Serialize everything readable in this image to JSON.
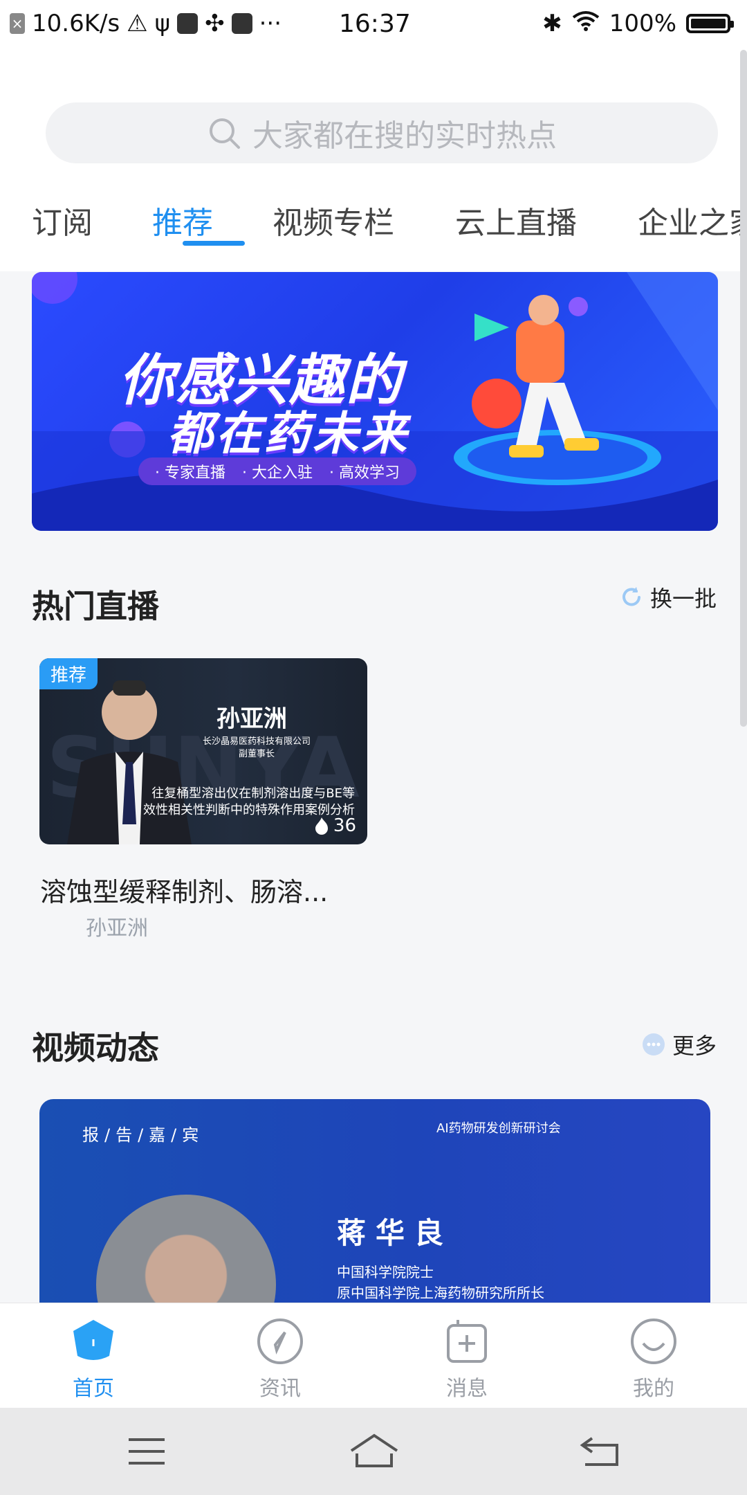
{
  "status_bar": {
    "speed": "10.6K/s",
    "time": "16:37",
    "battery": "100%",
    "more": "···"
  },
  "search": {
    "placeholder": "大家都在搜的实时热点"
  },
  "tabs": [
    "订阅",
    "推荐",
    "视频专栏",
    "云上直播",
    "企业之家"
  ],
  "active_tab": "推荐",
  "banner": {
    "title_line1": "你感兴趣的",
    "title_line2": "都在药未来",
    "tags": [
      "· 专家直播",
      "· 大企入驻",
      "· 高效学习"
    ]
  },
  "hot_live": {
    "section_title": "热门直播",
    "refresh_label": "换一批",
    "card": {
      "badge": "推荐",
      "speaker_name": "孙亚洲",
      "speaker_company": "长沙晶易医药科技有限公司",
      "speaker_role": "副董事长",
      "desc_line1": "往复桶型溶出仪在制剂溶出度与BE等",
      "desc_line2": "效性相关性判断中的特殊作用案例分析",
      "count": "36",
      "title": "溶蚀型缓释制剂、肠溶...",
      "author": "孙亚洲"
    }
  },
  "video_news": {
    "section_title": "视频动态",
    "more_label": "更多",
    "card": {
      "header": "报/告/嘉/宾",
      "event": "AI药物研发创新研讨会",
      "speaker_name": "蒋华良",
      "line1": "中国科学院院士",
      "line2": "原中国科学院上海药物研究所所长"
    }
  },
  "bottom_nav": [
    {
      "label": "首页",
      "active": true
    },
    {
      "label": "资讯",
      "active": false
    },
    {
      "label": "消息",
      "active": false
    },
    {
      "label": "我的",
      "active": false
    }
  ],
  "colors": {
    "accent": "#1f8ff0",
    "banner_blue": "#2b4bff",
    "inactive_gray": "#9a9ea5"
  }
}
